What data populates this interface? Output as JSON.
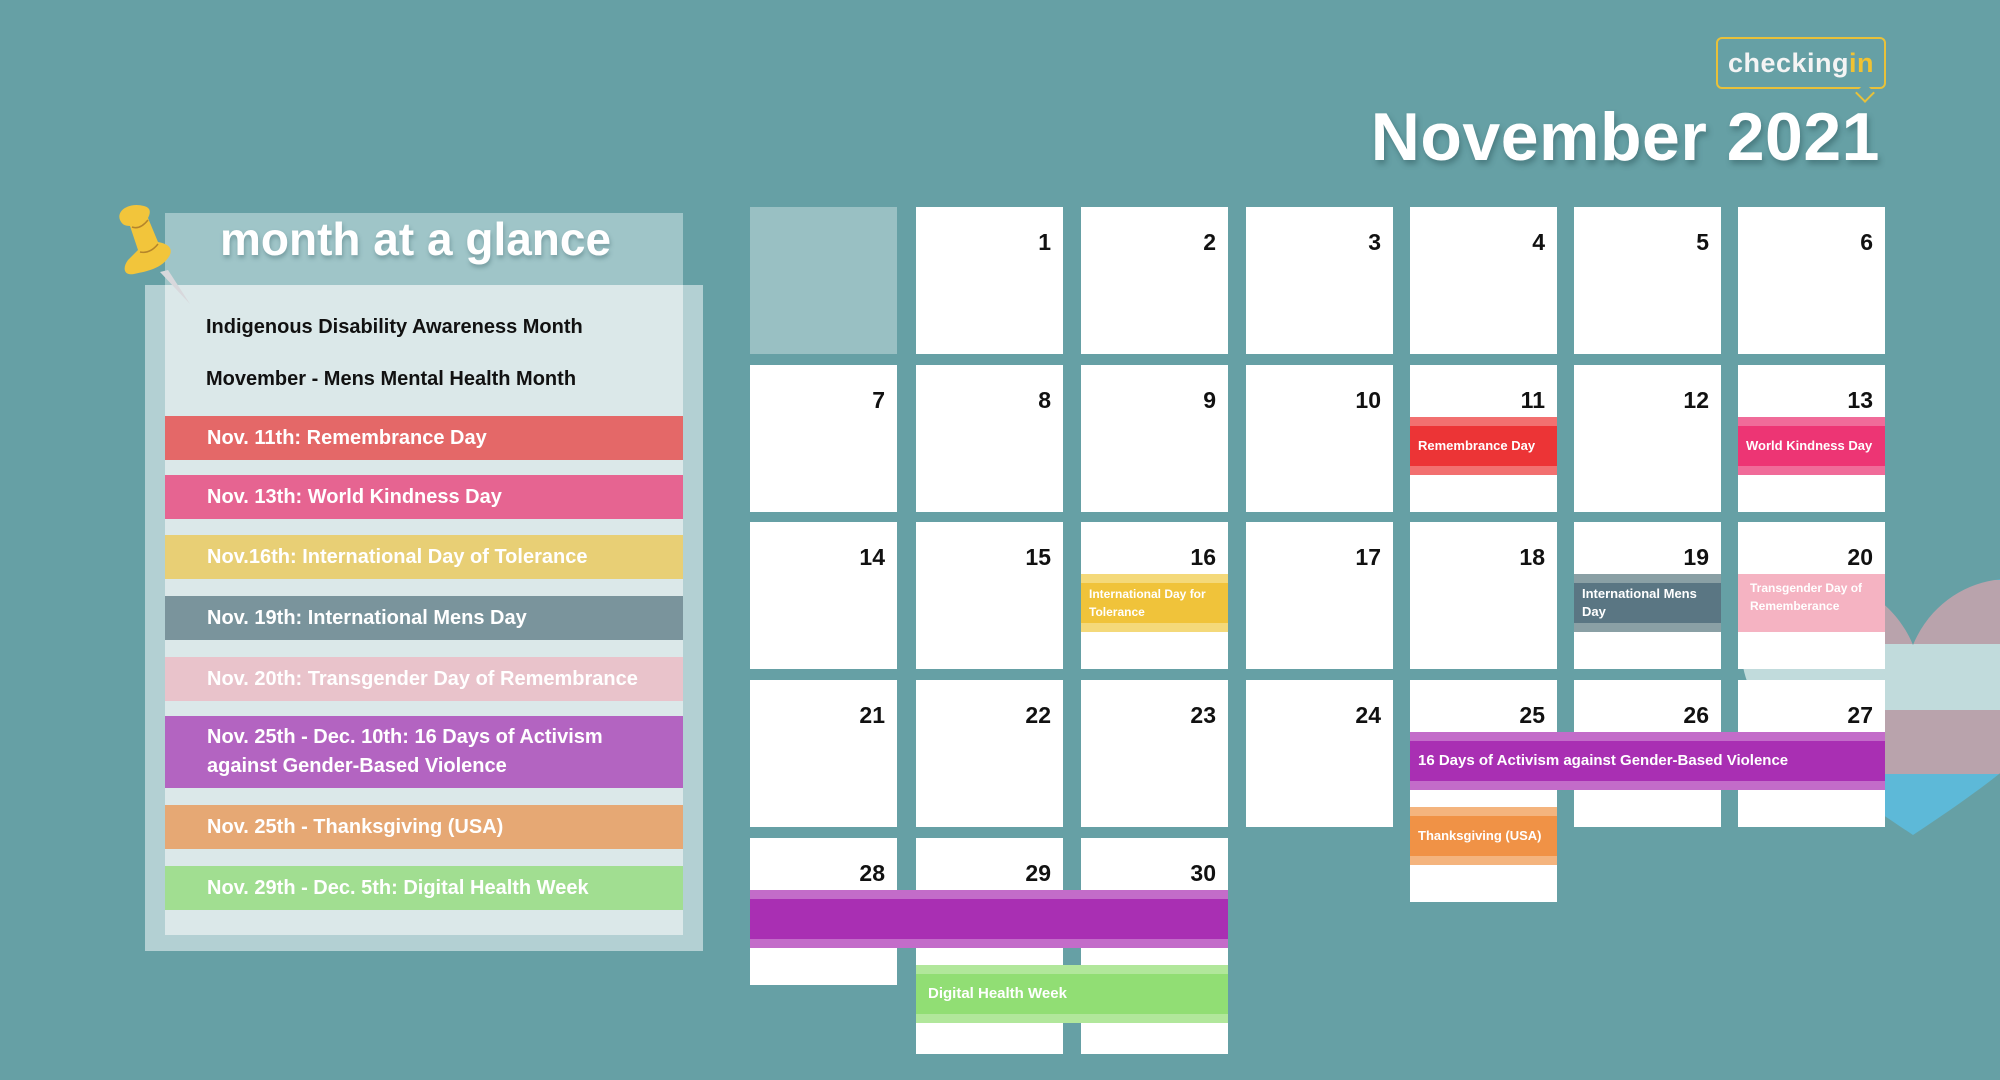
{
  "logo": {
    "text_main": "checking",
    "text_accent": "in"
  },
  "header": {
    "title": "November 2021"
  },
  "glance": {
    "title": "month at a glance",
    "month_notes": [
      "Indigenous Disability Awareness Month",
      "Movember - Mens Mental Health Month"
    ],
    "items": [
      {
        "label": "Nov. 11th:  Remembrance Day",
        "color": "#e46868"
      },
      {
        "label": "Nov. 13th: World Kindness Day",
        "color": "#e66491"
      },
      {
        "label": "Nov.16th: International Day of Tolerance",
        "color": "#e8cf75"
      },
      {
        "label": "Nov. 19th: International Mens Day",
        "color": "#7a949c"
      },
      {
        "label": "Nov. 20th: Transgender Day of Remembrance",
        "color": "#e9c3cb"
      },
      {
        "label": "Nov. 25th - Dec. 10th: 16 Days of Activism against Gender-Based Violence",
        "color": "#b364c1"
      },
      {
        "label": "Nov. 25th - Thanksgiving (USA)",
        "color": "#e6a874"
      },
      {
        "label": "Nov. 29th - Dec. 5th: Digital Health Week",
        "color": "#a1de91"
      }
    ]
  },
  "calendar": {
    "month": "November",
    "year": 2021,
    "first_weekday_index": 1,
    "days": 30,
    "events": [
      {
        "label": "Remembrance Day",
        "day": 11,
        "span": 1,
        "slot": 0,
        "color": "#ec3436",
        "light": "#f27070"
      },
      {
        "label": "World Kindness Day",
        "day": 13,
        "span": 1,
        "slot": 0,
        "color": "#ed3574",
        "light": "#f06b99"
      },
      {
        "label": "International  Day for Tolerance",
        "day": 16,
        "span": 1,
        "slot": 0,
        "color": "#f0c33a",
        "light": "#f4d97a"
      },
      {
        "label": "International Mens Day",
        "day": 19,
        "span": 1,
        "slot": 0,
        "color": "#5a7683",
        "light": "#8aa0a5"
      },
      {
        "label": "Transgender Day of Rememberance",
        "day": 20,
        "span": 1,
        "slot": 0,
        "color": "#f5b3c2",
        "light": "#f5b3c2"
      },
      {
        "label": "16 Days of Activism against Gender-Based Violence",
        "day": 25,
        "span": 3,
        "slot": 0,
        "color": "#a92fb3",
        "light": "#c36cc9"
      },
      {
        "label": "",
        "day": 28,
        "span": 3,
        "slot": 0,
        "color": "#a92fb3",
        "light": "#c36cc9"
      },
      {
        "label": "Thanksgiving (USA)",
        "day": 25,
        "span": 1,
        "slot": 1,
        "color": "#f09246",
        "light": "#f4b47e"
      },
      {
        "label": "Digital Health Week",
        "day": 29,
        "span": 2,
        "slot": 1,
        "color": "#91de74",
        "light": "#b1e79b"
      }
    ]
  }
}
